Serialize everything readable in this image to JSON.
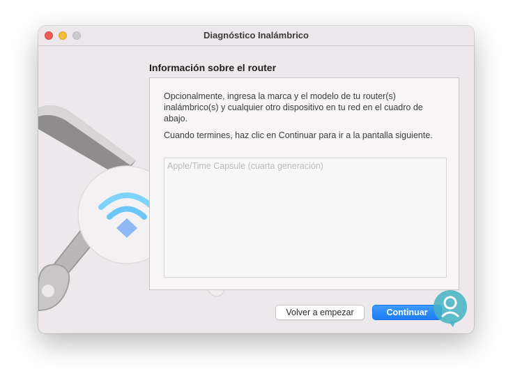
{
  "window": {
    "title": "Diagnóstico Inalámbrico"
  },
  "titlebar": {
    "buttons": [
      "close",
      "minimize",
      "zoom"
    ]
  },
  "illustration": {
    "icons": [
      "wrench-icon",
      "wifi-icon"
    ]
  },
  "main": {
    "heading": "Información sobre el router",
    "description_1": "Opcionalmente, ingresa la marca y el modelo de tu router(s) inalámbrico(s) y cualquier otro dispositivo en tu red en el cuadro de abajo.",
    "description_2": "Cuando termines, haz clic en Continuar para ir a la pantalla siguiente.",
    "input": {
      "value": "",
      "placeholder": "Apple/Time Capsule (cuarta generación)"
    }
  },
  "footer": {
    "restart_label": "Volver a empezar",
    "continue_label": "Continuar"
  },
  "colors": {
    "accent": "#1b7cf5",
    "window_bg": "#ede8eb",
    "close": "#ee5b54",
    "minimize": "#f5bd3c",
    "wifi": "#5ec4f5"
  }
}
